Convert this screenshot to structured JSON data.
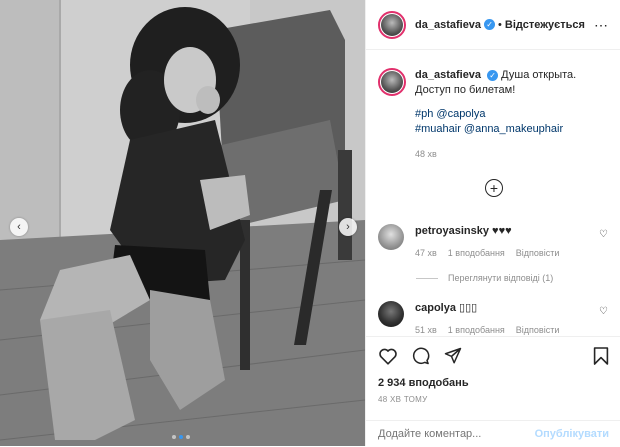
{
  "header": {
    "username": "da_astafieva",
    "separator": "•",
    "follow_label": "Відстежується",
    "more_icon": "more-dots-icon"
  },
  "caption": {
    "username": "da_astafieva",
    "text": "Душа открыта. Доступ по билетам!",
    "line2": "#ph @capolya",
    "line3": "#muahair @anna_makeuphair",
    "time": "48 хв"
  },
  "comments": [
    {
      "username": "petroyasinsky",
      "text": "♥♥♥",
      "time": "47 хв",
      "likes": "1 вподобання",
      "reply": "Відповісти"
    },
    {
      "username": "capolya",
      "text": "▯▯▯",
      "time": "51 хв",
      "likes": "1 вподобання",
      "reply": "Відповісти"
    }
  ],
  "view_replies": "Переглянути відповіді (1)",
  "stats": {
    "likes": "2 934 вподобань",
    "posted_ago": "48 ХВ ТОМУ"
  },
  "add_comment": {
    "placeholder": "Додайте коментар...",
    "post_label": "Опублікувати"
  },
  "colors": {
    "link": "#00376b",
    "accent": "#3897f0",
    "post_disabled": "#b3dbff"
  }
}
